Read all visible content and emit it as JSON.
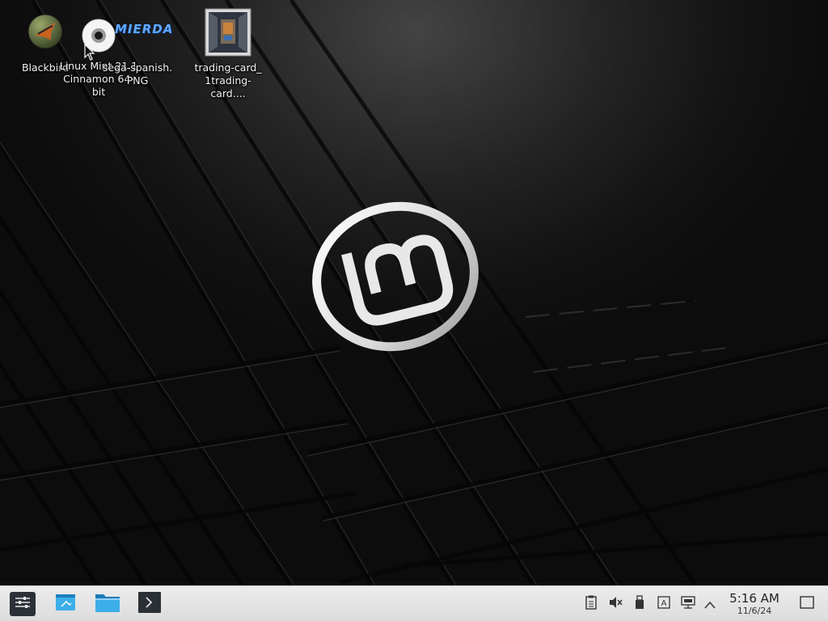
{
  "desktop": {
    "icons": [
      {
        "name": "blackbird",
        "label": "Blackbird",
        "icon": "blackbird-app-icon"
      },
      {
        "name": "linux-mint-disc",
        "label": "Linux Mint 21.1\nCinnamon 64-bit",
        "icon": "optical-disc-icon"
      },
      {
        "name": "sega-spanish-png",
        "label": "sega-spanish.\nPNG",
        "icon": "image-file-icon",
        "thumb_text": "MIERDA"
      },
      {
        "name": "trading-card",
        "label": "trading-card_\n1trading-card....",
        "icon": "photo-frame-icon"
      }
    ],
    "wallpaper": "linux-mint-logo"
  },
  "taskbar": {
    "launchers": [
      {
        "name": "menu-button",
        "icon": "menu-sliders-icon"
      },
      {
        "name": "show-desktop-launcher",
        "icon": "desktop-icon"
      },
      {
        "name": "file-manager-launcher",
        "icon": "folder-icon"
      },
      {
        "name": "terminal-launcher",
        "icon": "terminal-icon"
      }
    ],
    "tray": [
      {
        "name": "clipboard-tray",
        "icon": "clipboard-icon"
      },
      {
        "name": "volume-tray",
        "icon": "speaker-muted-icon"
      },
      {
        "name": "removable-drive-tray",
        "icon": "usb-drive-icon"
      },
      {
        "name": "keyboard-layout-tray",
        "icon": "keyboard-a-icon"
      },
      {
        "name": "network-tray",
        "icon": "network-wired-icon"
      },
      {
        "name": "tray-expand",
        "icon": "chevron-up-icon"
      }
    ],
    "clock": {
      "time": "5:16 AM",
      "date": "11/6/24"
    },
    "colors": {
      "bar": "#e4e4e4",
      "accent": "#3daee9"
    }
  }
}
